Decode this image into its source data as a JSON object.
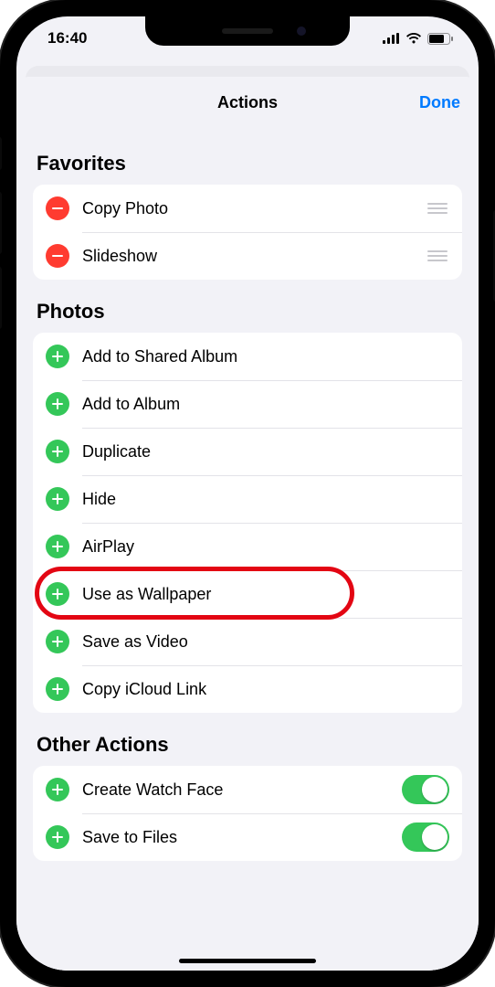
{
  "statusbar": {
    "time": "16:40"
  },
  "nav": {
    "title": "Actions",
    "done": "Done"
  },
  "sections": {
    "favorites": {
      "heading": "Favorites",
      "items": [
        {
          "label": "Copy Photo"
        },
        {
          "label": "Slideshow"
        }
      ]
    },
    "photos": {
      "heading": "Photos",
      "items": [
        {
          "label": "Add to Shared Album"
        },
        {
          "label": "Add to Album"
        },
        {
          "label": "Duplicate"
        },
        {
          "label": "Hide"
        },
        {
          "label": "AirPlay"
        },
        {
          "label": "Use as Wallpaper"
        },
        {
          "label": "Save as Video"
        },
        {
          "label": "Copy iCloud Link"
        }
      ]
    },
    "other": {
      "heading": "Other Actions",
      "items": [
        {
          "label": "Create Watch Face"
        },
        {
          "label": "Save to Files"
        }
      ]
    }
  },
  "highlightIndex": 5,
  "colors": {
    "accent": "#007aff",
    "green": "#34c759",
    "red": "#ff3b30"
  }
}
